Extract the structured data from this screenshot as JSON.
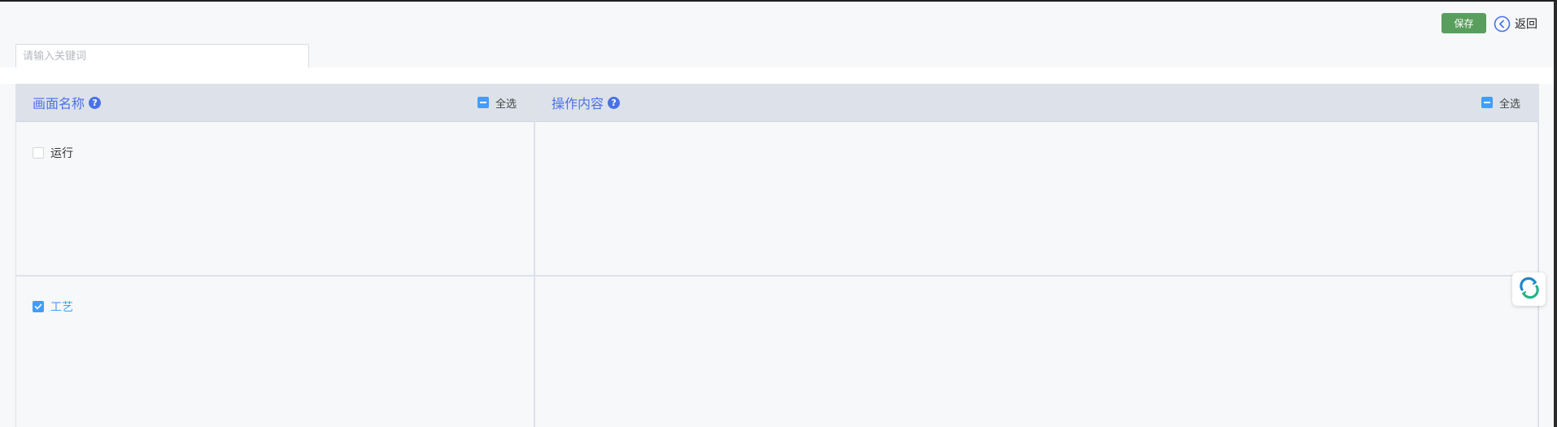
{
  "toolbar": {
    "save_label": "保存",
    "back_label": "返回"
  },
  "search": {
    "placeholder": "请输入关键词",
    "value": ""
  },
  "columns": {
    "screen": {
      "title": "画面名称",
      "select_all_label": "全选",
      "select_all_state": "indeterminate"
    },
    "operation": {
      "title": "操作内容",
      "select_all_label": "全选",
      "select_all_state": "indeterminate"
    }
  },
  "rows": [
    {
      "label": "运行",
      "checked": false
    },
    {
      "label": "工艺",
      "checked": true
    }
  ],
  "colors": {
    "accent": "#409eff",
    "title_blue": "#4a72e8",
    "save_green": "#5a9e5e",
    "header_bg": "#dde2ea"
  },
  "icons": {
    "help": "help-icon",
    "back": "chevron-left-circle-icon",
    "refresh": "refresh-icon"
  }
}
